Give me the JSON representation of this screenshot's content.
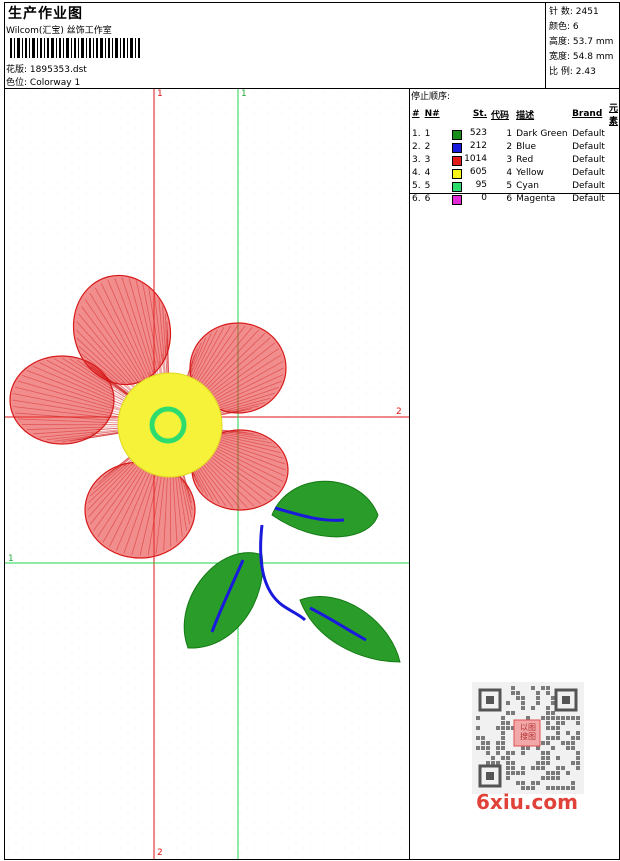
{
  "header": {
    "title": "生产作业图",
    "studio": "Wilcom(汇宝) 丝饰工作室",
    "design_label": "花版:",
    "design_value": "1895353.dst",
    "colorway_label": "色位:",
    "colorway_value": "Colorway 1"
  },
  "stats": [
    {
      "label": "针 数:",
      "value": "2451"
    },
    {
      "label": "颜色:",
      "value": "6"
    },
    {
      "label": "高度:",
      "value": "53.7 mm"
    },
    {
      "label": "宽度:",
      "value": "54.8 mm"
    },
    {
      "label": "比 例:",
      "value": "2.43"
    }
  ],
  "sequence": {
    "title": "停止顺序:",
    "headers": [
      "#",
      "N#",
      "St.",
      "代码",
      "描述",
      "Brand",
      "元素"
    ],
    "rows": [
      {
        "idx": "1.",
        "n": "1",
        "color": "#1a8c1a",
        "st": "523",
        "code": "1",
        "desc": "Dark Green",
        "brand": "Default"
      },
      {
        "idx": "2.",
        "n": "2",
        "color": "#1a1adc",
        "st": "212",
        "code": "2",
        "desc": "Blue",
        "brand": "Default"
      },
      {
        "idx": "3.",
        "n": "3",
        "color": "#e21a1a",
        "st": "1014",
        "code": "3",
        "desc": "Red",
        "brand": "Default"
      },
      {
        "idx": "4.",
        "n": "4",
        "color": "#f5f51a",
        "st": "605",
        "code": "4",
        "desc": "Yellow",
        "brand": "Default"
      },
      {
        "idx": "5.",
        "n": "5",
        "color": "#2edc6e",
        "st": "95",
        "code": "5",
        "desc": "Cyan",
        "brand": "Default"
      },
      {
        "idx": "6.",
        "n": "6",
        "color": "#e22ad6",
        "st": "0",
        "code": "6",
        "desc": "Magenta",
        "brand": "Default"
      }
    ]
  },
  "axes": {
    "red_top": "1",
    "red_right": "2",
    "red_bottom": "2",
    "green_top": "1",
    "green_left": "1"
  },
  "watermark": {
    "logo": "6xiu.com",
    "stamp": "以图 搜图"
  },
  "colors": {
    "red": "#e21a1a",
    "green": "#1a8c1a",
    "yellow": "#f5f51a",
    "blue": "#1a1adc",
    "cyan": "#2edc6e",
    "redline": "#e01515",
    "greenline": "#22d34a"
  }
}
